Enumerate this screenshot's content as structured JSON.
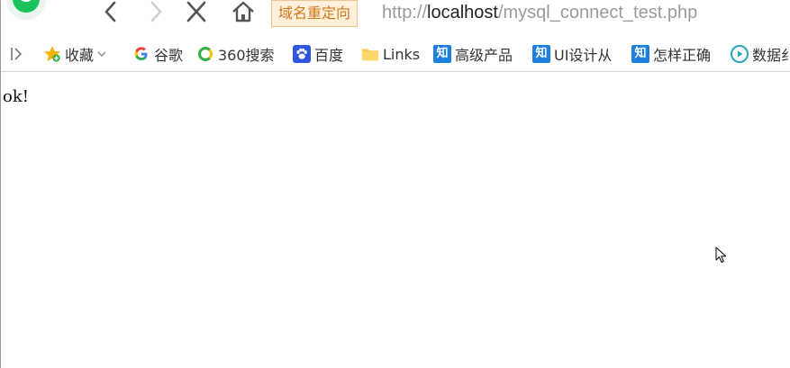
{
  "navbar": {
    "redirect_label": "域名重定向",
    "url_scheme": "http://",
    "url_host": "localhost",
    "url_path": "/mysql_connect_test.php"
  },
  "bookmarks": {
    "items": [
      {
        "label": "收藏",
        "icon": "star-icon"
      },
      {
        "label": "谷歌",
        "icon": "google-icon"
      },
      {
        "label": "360搜索",
        "icon": "360-search-icon"
      },
      {
        "label": "百度",
        "icon": "baidu-paw-icon"
      },
      {
        "label": "Links",
        "icon": "folder-icon"
      },
      {
        "label": "高级产品",
        "icon": "zhihu-icon",
        "badge": "知"
      },
      {
        "label": "UI设计从",
        "icon": "zhihu-icon",
        "badge": "知"
      },
      {
        "label": "怎样正确",
        "icon": "zhihu-icon",
        "badge": "知"
      },
      {
        "label": "数据纟",
        "icon": "play-circle-icon"
      }
    ]
  },
  "content": {
    "text": "ok!"
  },
  "colors": {
    "redirect_bg": "#fff0dc",
    "redirect_text": "#d07a1f",
    "url_muted": "#9a9a9a",
    "url_host": "#222222",
    "zhihu_blue": "#1a7fe0"
  }
}
